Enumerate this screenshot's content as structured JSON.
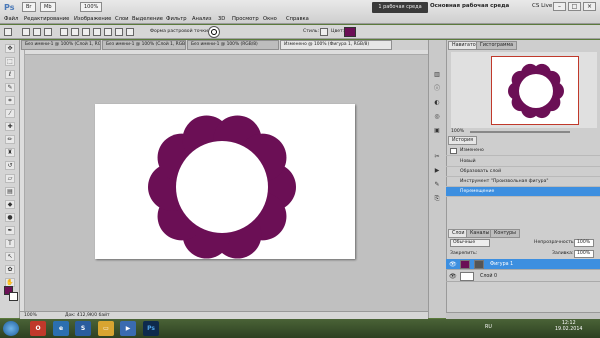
{
  "app": {
    "logo": "Ps",
    "workspace_button": "1 рабочая среда",
    "workspace_label": "Основная рабочая среда",
    "cs_live": "CS Live",
    "zoom": "100%",
    "menu": [
      "Файл",
      "Редактирование",
      "Изображение",
      "Слои",
      "Выделение",
      "Фильтр",
      "Анализ",
      "3D",
      "Просмотр",
      "Окно",
      "Справка"
    ],
    "window_controls": [
      "–",
      "□",
      "×"
    ]
  },
  "options": {
    "shape_label": "Форма растровой точки:",
    "styles_label": "Стиль:",
    "color_label": "Цвет:",
    "color": "#6b0f55"
  },
  "tabs": [
    {
      "label": "Без имени-1 @ 100% (Слой 1, RGB/8)"
    },
    {
      "label": "Без имени-1 @ 100% (Слой 1, RGB/8)"
    },
    {
      "label": "Без имени-1 @ 100% (RGB/8)"
    },
    {
      "label": "Изменено @ 100% (Фигура 1, RGB/8)"
    }
  ],
  "status": {
    "zoom": "100%",
    "doc": "Док: 412,9K/0 байт"
  },
  "navigator": {
    "tab": "Навигатор",
    "tab2": "Гистограмма",
    "zoom": "100%"
  },
  "history": {
    "tab": "История",
    "snapshot": "Изменено",
    "items": [
      "Новый",
      "Образовать слой",
      "Инструмент \"Произвольная фигура\"",
      "Перемещение"
    ]
  },
  "layers": {
    "tabs": [
      "Слои",
      "Каналы",
      "Контуры"
    ],
    "blend_mode": "Обычные",
    "opacity_label": "Непрозрачность:",
    "opacity": "100%",
    "lock_label": "Закрепить:",
    "fill_label": "Заливка:",
    "fill": "100%",
    "items": [
      "Фигура 1",
      "Слой 0"
    ]
  },
  "taskbar": {
    "lang": "RU",
    "time": "12:12",
    "date": "19.02.2014"
  },
  "shape_color": "#6b0f55",
  "accent": "#3d8fe0"
}
